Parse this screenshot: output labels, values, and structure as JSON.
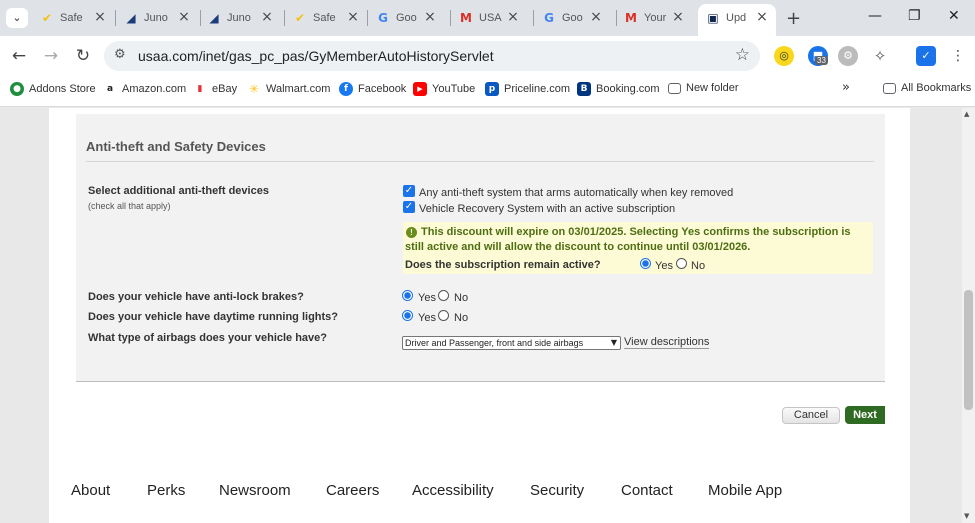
{
  "browser": {
    "tabs": [
      {
        "label": "Safe",
        "icon": "norton-check-icon",
        "glyph": "✔",
        "color": "#f4c20d"
      },
      {
        "label": "Juno",
        "icon": "juno-icon",
        "glyph": "◢",
        "color": "#1c3d7a"
      },
      {
        "label": "Juno",
        "icon": "juno-icon",
        "glyph": "◢",
        "color": "#1c3d7a"
      },
      {
        "label": "Safe",
        "icon": "norton-check-icon",
        "glyph": "✔",
        "color": "#f4c20d"
      },
      {
        "label": "Goo",
        "icon": "google-icon",
        "glyph": "G",
        "color": "#4285f4"
      },
      {
        "label": "USA",
        "icon": "gmail-icon",
        "glyph": "M",
        "color": "#d93025"
      },
      {
        "label": "Goo",
        "icon": "google-icon",
        "glyph": "G",
        "color": "#4285f4"
      },
      {
        "label": "Your",
        "icon": "gmail-icon",
        "glyph": "M",
        "color": "#d93025"
      },
      {
        "label": "Upd",
        "icon": "usaa-icon",
        "glyph": "▣",
        "color": "#12284c",
        "active": true
      }
    ],
    "url": "usaa.com/inet/gas_pc_pas/GyMemberAutoHistoryServlet",
    "extension_badge": "33",
    "bookmarks": [
      {
        "label": "Addons Store",
        "icon": "addons-store-icon",
        "color": "#1e8e3e"
      },
      {
        "label": "Amazon.com",
        "icon": "amazon-icon",
        "color": "#222222"
      },
      {
        "label": "eBay",
        "icon": "ebay-icon",
        "color": "#e53238"
      },
      {
        "label": "Walmart.com",
        "icon": "walmart-icon",
        "color": "#ffc220"
      },
      {
        "label": "Facebook",
        "icon": "facebook-icon",
        "color": "#1877f2"
      },
      {
        "label": "YouTube",
        "icon": "youtube-icon",
        "color": "#ff0000"
      },
      {
        "label": "Priceline.com",
        "icon": "priceline-icon",
        "color": "#0a58c2"
      },
      {
        "label": "Booking.com",
        "icon": "booking-icon",
        "color": "#003580"
      },
      {
        "label": "New folder",
        "icon": "folder-icon",
        "color": "#5f6368"
      }
    ],
    "all_bookmarks": "All Bookmarks"
  },
  "form": {
    "section_title": "Anti-theft and Safety Devices",
    "anti_theft": {
      "question": "Select additional anti-theft devices",
      "hint": "(check all that apply)",
      "options": [
        {
          "label": "Any anti-theft system that arms automatically when key removed",
          "checked": true
        },
        {
          "label": "Vehicle Recovery System with an active subscription",
          "checked": true
        }
      ]
    },
    "notice": {
      "text": "This discount will expire on 03/01/2025. Selecting Yes confirms the subscription is still active and will allow the discount to continue until 03/01/2026.",
      "question": "Does the subscription remain active?",
      "yes": "Yes",
      "no": "No",
      "selected": "Yes"
    },
    "abs": {
      "question": "Does your vehicle have anti-lock brakes?",
      "yes": "Yes",
      "no": "No",
      "selected": "Yes"
    },
    "drl": {
      "question": "Does your vehicle have daytime running lights?",
      "yes": "Yes",
      "no": "No",
      "selected": "Yes"
    },
    "airbags": {
      "question": "What type of airbags does your vehicle have?",
      "selected": "Driver and Passenger, front and side airbags",
      "link": "View descriptions"
    },
    "buttons": {
      "cancel": "Cancel",
      "next": "Next"
    }
  },
  "footer": {
    "links": [
      "About",
      "Perks",
      "Newsroom",
      "Careers",
      "Accessibility",
      "Security",
      "Contact",
      "Mobile App"
    ]
  },
  "colors": {
    "next_button": "#2f6a22",
    "notice_bg": "#fdfbd6",
    "notice_text": "#4e6e12",
    "checkbox": "#1a73e8"
  }
}
